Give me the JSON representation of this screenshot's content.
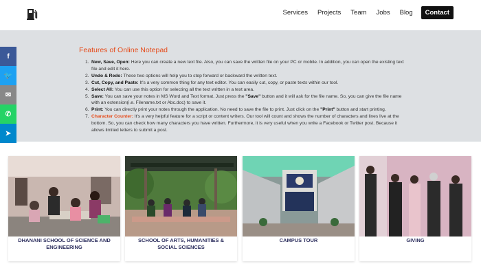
{
  "nav": {
    "items": [
      "Services",
      "Projects",
      "Team",
      "Jobs",
      "Blog"
    ],
    "contact": "Contact",
    "logo": "fuel-pump-icon"
  },
  "notepad": {
    "title": "Features of Online Notepad",
    "items": [
      {
        "n": "1.",
        "b": "New, Save, Open:",
        "t": " Here you can create a new text file. Also, you can save the written file on your PC or mobile. In addition, you can open the existing text file and edit it here."
      },
      {
        "n": "2.",
        "b": "Undo & Redo:",
        "t": " These two options will help you to step forward or backward the written text."
      },
      {
        "n": "3.",
        "b": "Cut, Copy, and Paste:",
        "t": " It's a very common thing for any text editor. You can easily cut, copy, or paste texts within our tool."
      },
      {
        "n": "4.",
        "b": "Select All:",
        "t": " You can use this option for selecting all the text written in a text area."
      },
      {
        "n": "5.",
        "b": "Save:",
        "t": " You can save your notes in MS Word and Text format. Just press the ",
        "b2": "\"Save\"",
        "t2": " button and it will ask for the file name. So, you can give the file name with an extension(i.e. Filename.txt or Abc.doc) to save it."
      },
      {
        "n": "6.",
        "b": "Print:",
        "t": " You can directly print your notes through the application. No need to save the file to print. Just click on the ",
        "b2": "\"Print\"",
        "t2": " button and start printing."
      },
      {
        "n": "7.",
        "b": "Character Counter:",
        "t": " It's a very helpful feature for a script or content writers. Our tool will count and shows the number of characters and lines live at the bottom. So, you can check how many characters you have written. Furthermore, it is very useful when you write a Facebook or Twitter post. Because it allows limited letters to submit a post."
      }
    ]
  },
  "share": [
    {
      "name": "facebook-share",
      "icon": "facebook-icon",
      "glyph": "f",
      "color": "#3b5998"
    },
    {
      "name": "twitter-share",
      "icon": "twitter-icon",
      "glyph": "🐦",
      "color": "#1da1f2"
    },
    {
      "name": "email-share",
      "icon": "email-icon",
      "glyph": "✉",
      "color": "#888888"
    },
    {
      "name": "whatsapp-share",
      "icon": "whatsapp-icon",
      "glyph": "✆",
      "color": "#25d366"
    },
    {
      "name": "telegram-share",
      "icon": "telegram-icon",
      "glyph": "➤",
      "color": "#0088cc"
    }
  ],
  "cards": [
    {
      "caption": "DHANANI SCHOOL OF SCIENCE AND ENGINEERING"
    },
    {
      "caption": "SCHOOL OF ARTS, HUMANITIES & SOCIAL SCIENCES"
    },
    {
      "caption": "CAMPUS TOUR"
    },
    {
      "caption": "GIVING"
    }
  ]
}
